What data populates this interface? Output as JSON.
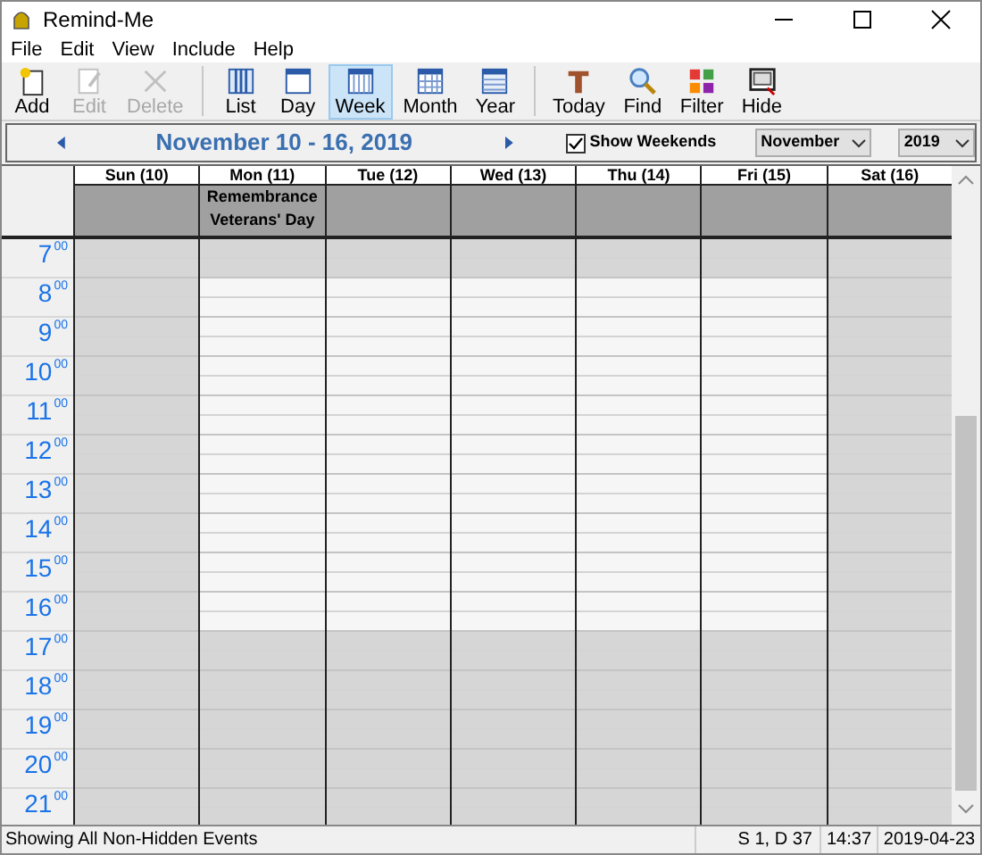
{
  "window": {
    "title": "Remind-Me"
  },
  "menu": [
    "File",
    "Edit",
    "View",
    "Include",
    "Help"
  ],
  "toolbar": [
    {
      "kind": "add",
      "label": "Add",
      "disabled": false,
      "selected": false
    },
    {
      "kind": "edit",
      "label": "Edit",
      "disabled": true,
      "selected": false
    },
    {
      "kind": "delete",
      "label": "Delete",
      "disabled": true,
      "selected": false
    },
    {
      "kind": "separator"
    },
    {
      "kind": "list",
      "label": "List",
      "disabled": false,
      "selected": false
    },
    {
      "kind": "day",
      "label": "Day",
      "disabled": false,
      "selected": false
    },
    {
      "kind": "week",
      "label": "Week",
      "disabled": false,
      "selected": true
    },
    {
      "kind": "month",
      "label": "Month",
      "disabled": false,
      "selected": false
    },
    {
      "kind": "year",
      "label": "Year",
      "disabled": false,
      "selected": false
    },
    {
      "kind": "separator"
    },
    {
      "kind": "today",
      "label": "Today",
      "disabled": false,
      "selected": false
    },
    {
      "kind": "find",
      "label": "Find",
      "disabled": false,
      "selected": false
    },
    {
      "kind": "filter",
      "label": "Filter",
      "disabled": false,
      "selected": false
    },
    {
      "kind": "hide",
      "label": "Hide",
      "disabled": false,
      "selected": false
    }
  ],
  "nav": {
    "range": "November 10 - 16, 2019",
    "show_weekends": {
      "label": "Show Weekends",
      "checked": true
    },
    "month": "November",
    "year": "2019"
  },
  "days": [
    {
      "label": "Sun (10)",
      "weekend": true
    },
    {
      "label": "Mon (11)",
      "weekend": false,
      "events": [
        "Remembrance",
        "Veterans' Day"
      ]
    },
    {
      "label": "Tue (12)",
      "weekend": false
    },
    {
      "label": "Wed (13)",
      "weekend": false
    },
    {
      "label": "Thu (14)",
      "weekend": false
    },
    {
      "label": "Fri (15)",
      "weekend": false
    },
    {
      "label": "Sat (16)",
      "weekend": true
    }
  ],
  "hours": [
    {
      "hour": "7",
      "minutes": "00",
      "working": false
    },
    {
      "hour": "8",
      "minutes": "00",
      "working": true
    },
    {
      "hour": "9",
      "minutes": "00",
      "working": true
    },
    {
      "hour": "10",
      "minutes": "00",
      "working": true
    },
    {
      "hour": "11",
      "minutes": "00",
      "working": true
    },
    {
      "hour": "12",
      "minutes": "00",
      "working": true
    },
    {
      "hour": "13",
      "minutes": "00",
      "working": true
    },
    {
      "hour": "14",
      "minutes": "00",
      "working": true
    },
    {
      "hour": "15",
      "minutes": "00",
      "working": true
    },
    {
      "hour": "16",
      "minutes": "00",
      "working": true
    },
    {
      "hour": "17",
      "minutes": "00",
      "working": false
    },
    {
      "hour": "18",
      "minutes": "00",
      "working": false
    },
    {
      "hour": "19",
      "minutes": "00",
      "working": false
    },
    {
      "hour": "20",
      "minutes": "00",
      "working": false
    },
    {
      "hour": "21",
      "minutes": "00",
      "working": false
    }
  ],
  "status_bar": {
    "message": "Showing All Non-Hidden Events",
    "position": "S 1, D 37",
    "time": "14:37",
    "date": "2019-04-23"
  }
}
